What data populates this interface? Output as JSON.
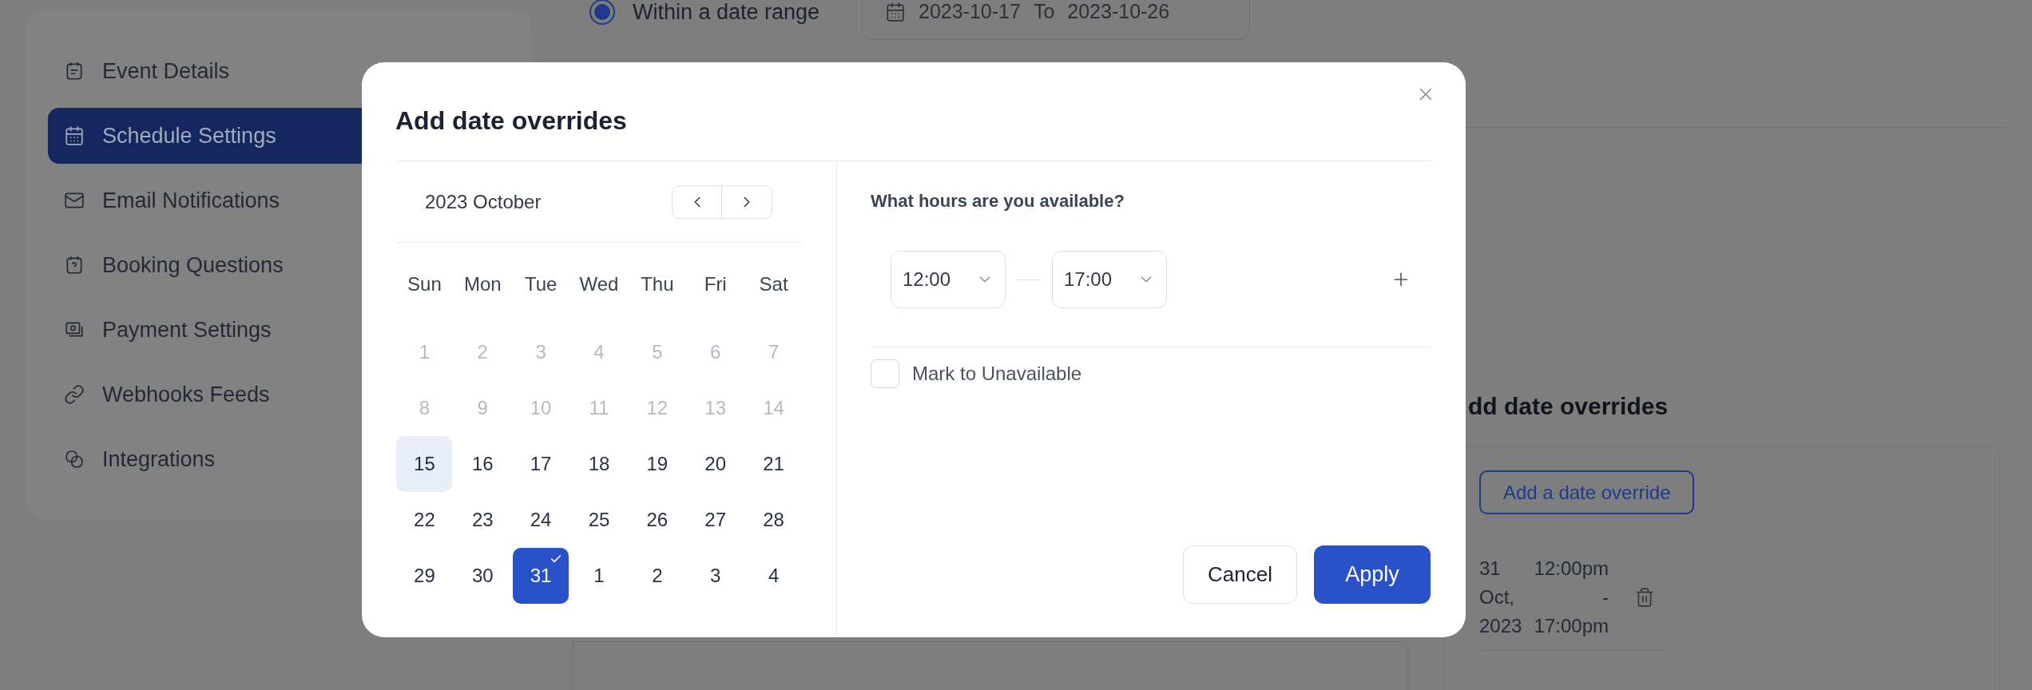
{
  "sidebar": {
    "items": [
      {
        "label": "Event Details",
        "selected": false
      },
      {
        "label": "Schedule Settings",
        "selected": true
      },
      {
        "label": "Email Notifications",
        "selected": false
      },
      {
        "label": "Booking Questions",
        "selected": false
      },
      {
        "label": "Payment Settings",
        "selected": false
      },
      {
        "label": "Webhooks Feeds",
        "selected": false
      },
      {
        "label": "Integrations",
        "selected": false
      }
    ]
  },
  "schedule": {
    "range_option": {
      "label": "Within a date range",
      "selected": true
    },
    "date_range": {
      "start": "2023-10-17",
      "separator": "To",
      "end": "2023-10-26"
    }
  },
  "overrides_section": {
    "heading": "dd date overrides",
    "add_button": "Add a date override",
    "entries": [
      {
        "date": "31 Oct, 2023",
        "time": "12:00pm - 17:00pm"
      }
    ]
  },
  "dialog": {
    "title": "Add date overrides",
    "calendar": {
      "month": "2023 October",
      "weekdays": [
        "Sun",
        "Mon",
        "Tue",
        "Wed",
        "Thu",
        "Fri",
        "Sat"
      ],
      "days": [
        {
          "label": "1",
          "kind": "muted",
          "selected": false
        },
        {
          "label": "2",
          "kind": "muted",
          "selected": false
        },
        {
          "label": "3",
          "kind": "muted",
          "selected": false
        },
        {
          "label": "4",
          "kind": "muted",
          "selected": false
        },
        {
          "label": "5",
          "kind": "muted",
          "selected": false
        },
        {
          "label": "6",
          "kind": "muted",
          "selected": false
        },
        {
          "label": "7",
          "kind": "muted",
          "selected": false
        },
        {
          "label": "8",
          "kind": "muted",
          "selected": false
        },
        {
          "label": "9",
          "kind": "muted",
          "selected": false
        },
        {
          "label": "10",
          "kind": "muted",
          "selected": false
        },
        {
          "label": "11",
          "kind": "muted",
          "selected": false
        },
        {
          "label": "12",
          "kind": "muted",
          "selected": false
        },
        {
          "label": "13",
          "kind": "muted",
          "selected": false
        },
        {
          "label": "14",
          "kind": "muted",
          "selected": false
        },
        {
          "label": "15",
          "kind": "today",
          "selected": false
        },
        {
          "label": "16",
          "kind": "normal",
          "selected": false
        },
        {
          "label": "17",
          "kind": "normal",
          "selected": false
        },
        {
          "label": "18",
          "kind": "normal",
          "selected": false
        },
        {
          "label": "19",
          "kind": "normal",
          "selected": false
        },
        {
          "label": "20",
          "kind": "normal",
          "selected": false
        },
        {
          "label": "21",
          "kind": "normal",
          "selected": false
        },
        {
          "label": "22",
          "kind": "normal",
          "selected": false
        },
        {
          "label": "23",
          "kind": "normal",
          "selected": false
        },
        {
          "label": "24",
          "kind": "normal",
          "selected": false
        },
        {
          "label": "25",
          "kind": "normal",
          "selected": false
        },
        {
          "label": "26",
          "kind": "normal",
          "selected": false
        },
        {
          "label": "27",
          "kind": "normal",
          "selected": false
        },
        {
          "label": "28",
          "kind": "normal",
          "selected": false
        },
        {
          "label": "29",
          "kind": "normal",
          "selected": false
        },
        {
          "label": "30",
          "kind": "normal",
          "selected": false
        },
        {
          "label": "31",
          "kind": "normal",
          "selected": true
        },
        {
          "label": "1",
          "kind": "normal",
          "selected": false
        },
        {
          "label": "2",
          "kind": "normal",
          "selected": false
        },
        {
          "label": "3",
          "kind": "normal",
          "selected": false
        },
        {
          "label": "4",
          "kind": "normal",
          "selected": false
        }
      ]
    },
    "question": "What hours are you available?",
    "start_time": "12:00",
    "end_time": "17:00",
    "unavailable": {
      "label": "Mark to Unavailable",
      "checked": false
    },
    "cancel_button": "Cancel",
    "apply_button": "Apply"
  }
}
